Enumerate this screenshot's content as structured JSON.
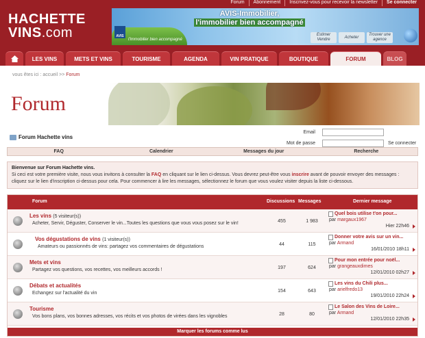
{
  "header": {
    "logo_line1": "HACHETTE",
    "logo_line2": "VINS",
    "logo_suffix": ".com",
    "toplinks": [
      "Forum",
      "Abonnement",
      "Inscrivez-vous pour recevoir la newsletter",
      "Se connecter"
    ]
  },
  "banner": {
    "headline1": "AVIS-Immobilier,",
    "headline2": "l'immobilier bien accompagné",
    "brand": "AVIS",
    "tagline": "l'immobilier bien accompagné",
    "buttons": [
      "Estimer Vendre",
      "Acheter",
      "Trouver une agence"
    ]
  },
  "nav": {
    "tabs": [
      "LES VINS",
      "METS ET VINS",
      "TOURISME",
      "AGENDA",
      "VIN PRATIQUE",
      "BOUTIQUE",
      "FORUM",
      "BLOG"
    ],
    "active": "FORUM"
  },
  "breadcrumb": {
    "prefix": "vous êtes ici :",
    "home": "accueil",
    "sep": ">>",
    "current": "Forum"
  },
  "forum_banner_title": "Forum",
  "forum_title": "Forum Hachette vins",
  "login": {
    "email_label": "Email",
    "password_label": "Mot de passe",
    "email_value": "",
    "password_value": "",
    "connect_label": "Se connecter"
  },
  "subnav": [
    "FAQ",
    "Calendrier",
    "Messages du jour",
    "Recherche"
  ],
  "welcome": {
    "title": "Bienvenue sur Forum Hachette vins.",
    "body_1": "Si ceci est votre première visite, nous vous invitons à consulter la ",
    "faq": "FAQ",
    "body_2": " en cliquant sur le lien ci-dessus. Vous devrez peut-être vous ",
    "inscrire": "inscrire",
    "body_3": " avant de pouvoir envoyer des messages : cliquez sur le lien d'inscription ci-dessus pour cela. Pour commencer à lire les messages, sélectionnez le forum que vous voulez visiter depuis la liste ci-dessous."
  },
  "table": {
    "headers": {
      "forum": "Forum",
      "discussions": "Discussions",
      "messages": "Messages",
      "last": "Dernier message"
    },
    "rows": [
      {
        "name": "Les vins",
        "visitors": "(5 visiteur(s))",
        "desc": "Acheter, Servir, Déguster, Conserver le vin...Toutes les questions que vous vous posez sur le vin!",
        "discussions": "455",
        "messages": "1 983",
        "last_title": "Quel bois utilise t'on pour...",
        "last_by_prefix": "par",
        "last_by": "margaux1967",
        "last_date": "Hier 22h46"
      },
      {
        "name": "Vos dégustations de vins",
        "visitors": "(1 visiteur(s))",
        "desc": "Amateurs ou passionnés de vins: partagez vos commentaires de dégustations",
        "discussions": "44",
        "messages": "115",
        "last_title": "Donner votre avis sur un vin...",
        "last_by_prefix": "par",
        "last_by": "Armand",
        "last_date": "16/01/2010 18h11"
      },
      {
        "name": "Mets et vins",
        "visitors": "",
        "desc": "Partagez vos questions, vos recettes, vos meilleurs accords !",
        "discussions": "197",
        "messages": "624",
        "last_title": "Pour mon entrée pour noël...",
        "last_by_prefix": "par",
        "last_by": "grangeauxdimes",
        "last_date": "12/01/2010 02h27"
      },
      {
        "name": "Débats et actualités",
        "visitors": "",
        "desc": "Echangez sur l'actualité du vin",
        "discussions": "154",
        "messages": "643",
        "last_title": "Les vins du Chili plus...",
        "last_by_prefix": "par",
        "last_by": "arielfredo13",
        "last_date": "19/01/2010 22h24"
      },
      {
        "name": "Tourisme",
        "visitors": "",
        "desc": "Vos bons plans, vos bonnes adresses, vos récits et vos photos de virées dans les vignobles",
        "discussions": "28",
        "messages": "80",
        "last_title": "Le Salon des Vins de Loire...",
        "last_by_prefix": "par",
        "last_by": "Armand",
        "last_date": "12/01/2010 22h35"
      }
    ],
    "footer": "Marquer les forums comme lus"
  },
  "colors": {
    "brand": "#9a1f25",
    "accent": "#b0282c",
    "light": "#f7ecea"
  }
}
